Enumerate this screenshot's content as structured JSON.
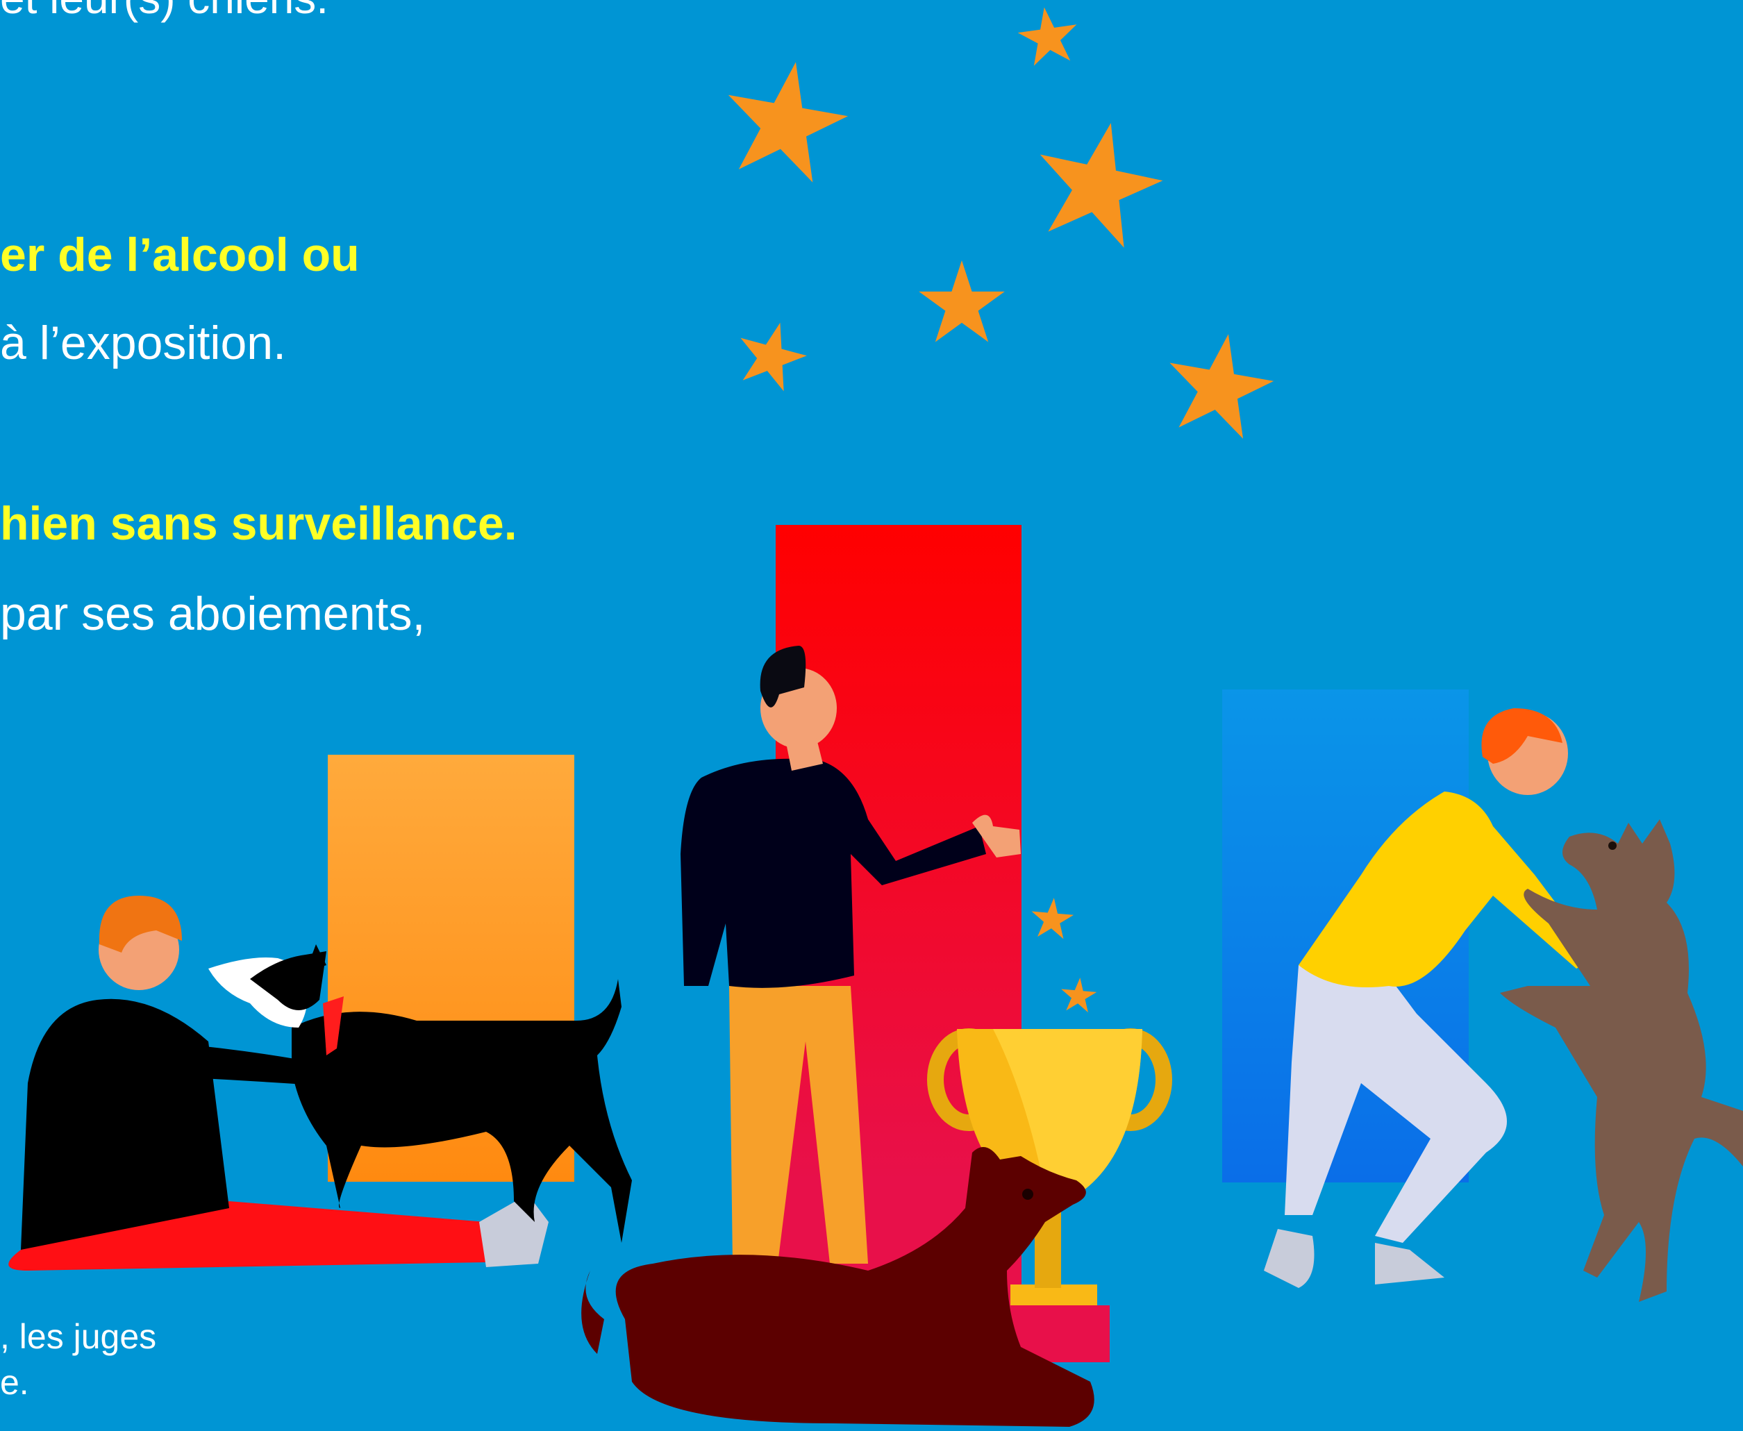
{
  "text_lines": {
    "top_partial": "et leur(s) chiens.",
    "highlight_1": "er de l’alcool ou",
    "line_1": "à l’exposition.",
    "highlight_2": "hien sans surveillance.",
    "line_2": "par ses aboiements,",
    "footnote_1": ", les juges",
    "footnote_2": "e."
  },
  "colors": {
    "background": "#0095d4",
    "highlight_text": "#ffff26",
    "body_text": "#ffffff",
    "star": "#f7931e",
    "orange_bar": "#ff9a2e",
    "red_bar": "#ff0a1e",
    "blue_bar": "#0a86e8",
    "trophy_gold": "#f9b916"
  },
  "illustration": {
    "icons": [
      "star-icon",
      "trophy-icon",
      "dog-icon",
      "person-icon"
    ]
  }
}
